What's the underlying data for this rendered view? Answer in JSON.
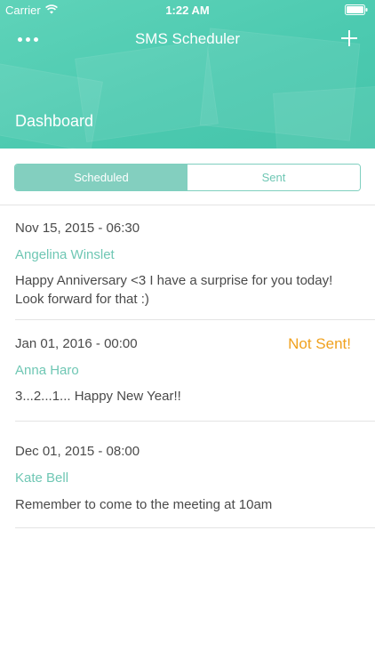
{
  "status_bar": {
    "carrier": "Carrier",
    "time": "1:22 AM"
  },
  "navbar": {
    "title": "SMS Scheduler"
  },
  "dashboard": {
    "title": "Dashboard"
  },
  "segments": {
    "scheduled": "Scheduled",
    "sent": "Sent"
  },
  "messages": [
    {
      "date": "Nov 15, 2015 - 06:30",
      "name": "Angelina Winslet",
      "text": "Happy Anniversary <3 I have a surprise for you today! Look forward for that :)",
      "status": ""
    },
    {
      "date": "Jan 01, 2016 - 00:00",
      "name": "Anna Haro",
      "text": "3...2...1... Happy New Year!!",
      "status": "Not Sent!"
    },
    {
      "date": "Dec 01, 2015 - 08:00",
      "name": "Kate Bell",
      "text": "Remember to come to the meeting at 10am",
      "status": ""
    }
  ],
  "colors": {
    "accent": "#4ccab0",
    "warning": "#f0a11e"
  }
}
